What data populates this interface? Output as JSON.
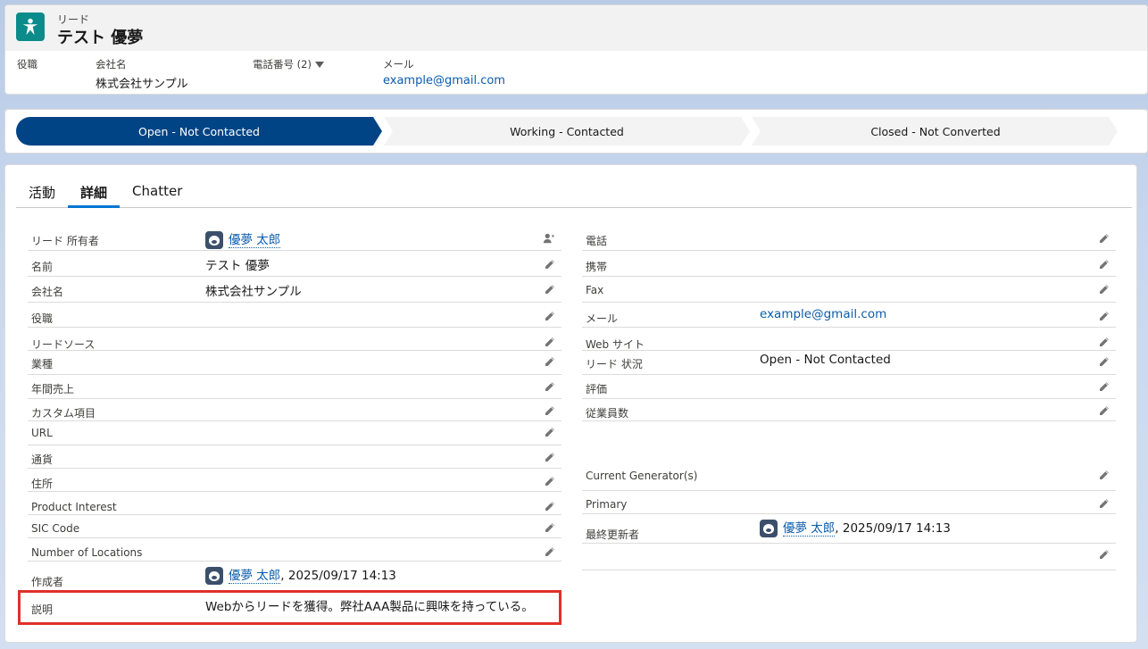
{
  "header": {
    "record_type": "リード",
    "record_name": "テスト 優夢",
    "fields": [
      {
        "label": "役職",
        "value": ""
      },
      {
        "label": "会社名",
        "value": "株式会社サンプル"
      },
      {
        "label": "電話番号 (2)",
        "value": ""
      },
      {
        "label": "メール",
        "value": "example@gmail.com"
      }
    ]
  },
  "path": {
    "stages": [
      "Open - Not Contacted",
      "Working - Contacted",
      "Closed - Not Converted"
    ],
    "current_index": 0
  },
  "tabs": [
    "活動",
    "詳細",
    "Chatter"
  ],
  "active_tab": 1,
  "left_fields": [
    {
      "label": "リード 所有者",
      "value": "優夢 太郎",
      "type": "user"
    },
    {
      "label": "名前",
      "value": "テスト 優夢"
    },
    {
      "label": "会社名",
      "value": "株式会社サンプル"
    },
    {
      "label": "役職",
      "value": ""
    },
    {
      "label": "リードソース",
      "value": ""
    },
    {
      "label": "業種",
      "value": ""
    },
    {
      "label": "年間売上",
      "value": ""
    },
    {
      "label": "カスタム項目",
      "value": ""
    },
    {
      "label": "URL",
      "value": ""
    },
    {
      "label": "通貨",
      "value": ""
    },
    {
      "label": "住所",
      "value": ""
    },
    {
      "label": "Product Interest",
      "value": ""
    },
    {
      "label": "SIC Code",
      "value": ""
    },
    {
      "label": "Number of Locations",
      "value": ""
    },
    {
      "label": "作成者",
      "value": "優夢 太郎",
      "suffix": ", 2025/09/17 14:13",
      "type": "user"
    },
    {
      "label": "説明",
      "value": "Webからリードを獲得。弊社AAA製品に興味を持っている。"
    }
  ],
  "right_fields": [
    {
      "label": "電話",
      "value": ""
    },
    {
      "label": "携帯",
      "value": ""
    },
    {
      "label": "Fax",
      "value": ""
    },
    {
      "label": "メール",
      "value": "example@gmail.com",
      "type": "link"
    },
    {
      "label": "Web サイト",
      "value": ""
    },
    {
      "label": "リード 状況",
      "value": "Open - Not Contacted"
    },
    {
      "label": "評価",
      "value": ""
    },
    {
      "label": "従業員数",
      "value": ""
    },
    {
      "label": "Current Generator(s)",
      "value": ""
    },
    {
      "label": "Primary",
      "value": ""
    },
    {
      "label": "最終更新者",
      "value": "優夢 太郎",
      "suffix": ", 2025/09/17 14:13",
      "type": "user"
    }
  ],
  "colors": {
    "path_current": "#014486",
    "brand_icon": "#0b8c8b",
    "link": "#0b5cab",
    "highlight": "#e0302a"
  }
}
